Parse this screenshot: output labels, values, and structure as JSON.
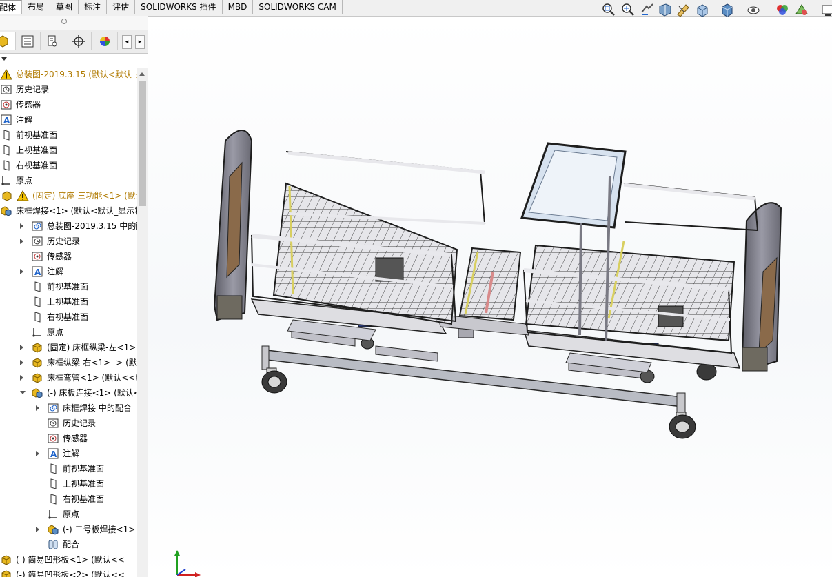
{
  "tabs": [
    {
      "label": "配体",
      "active": true
    },
    {
      "label": "布局",
      "active": false
    },
    {
      "label": "草图",
      "active": false
    },
    {
      "label": "标注",
      "active": false
    },
    {
      "label": "评估",
      "active": false
    },
    {
      "label": "SOLIDWORKS 插件",
      "active": false
    },
    {
      "label": "MBD",
      "active": false
    },
    {
      "label": "SOLIDWORKS CAM",
      "active": false
    }
  ],
  "heads_up_toolbar": [
    "zoom-to-fit-icon",
    "zoom-to-area-icon",
    "previous-view-icon",
    "section-view-icon",
    "dynamic-annotation-icon",
    "view-orientation-icon",
    "display-style-icon",
    "hide-show-items-icon",
    "edit-appearance-icon",
    "apply-scene-icon",
    "view-settings-icon"
  ],
  "pane_tabs": [
    "feature-manager-icon",
    "property-manager-icon",
    "configuration-manager-icon",
    "dimxpert-manager-icon",
    "display-manager-icon"
  ],
  "tree": [
    {
      "label": "总装图-2019.3.15  (默认<默认_显",
      "icon": "warning-icon",
      "warn": true
    },
    {
      "label": "历史记录",
      "icon": "history-icon"
    },
    {
      "label": "传感器",
      "icon": "sensor-icon"
    },
    {
      "label": "注解",
      "icon": "annotation-icon"
    },
    {
      "label": "前视基准面",
      "icon": "plane-icon"
    },
    {
      "label": "上视基准面",
      "icon": "plane-icon"
    },
    {
      "label": "右视基准面",
      "icon": "plane-icon"
    },
    {
      "label": "原点",
      "icon": "origin-icon"
    },
    {
      "label": "(固定) 底座-三功能<1> (默认",
      "icon": "part-warning-icon",
      "warn": true
    },
    {
      "label": "床框焊接<1> (默认<默认_显示状",
      "icon": "subassembly-icon"
    },
    {
      "label": "总装图-2019.3.15 中的配合",
      "icon": "mates-folder-icon"
    },
    {
      "label": "历史记录",
      "icon": "history-icon"
    },
    {
      "label": "传感器",
      "icon": "sensor-icon"
    },
    {
      "label": "注解",
      "icon": "annotation-icon"
    },
    {
      "label": "前视基准面",
      "icon": "plane-icon"
    },
    {
      "label": "上视基准面",
      "icon": "plane-icon"
    },
    {
      "label": "右视基准面",
      "icon": "plane-icon"
    },
    {
      "label": "原点",
      "icon": "origin-icon"
    },
    {
      "label": "(固定) 床框纵梁-左<1> (默认",
      "icon": "part-icon"
    },
    {
      "label": "床框纵梁-右<1> -> (默认<",
      "icon": "part-icon"
    },
    {
      "label": "床框弯管<1> (默认<<默认>",
      "icon": "part-icon"
    },
    {
      "label": "(-) 床板连接<1> (默认<默认",
      "icon": "subassembly-icon"
    },
    {
      "label": "床框焊接 中的配合",
      "icon": "mates-folder-icon"
    },
    {
      "label": "历史记录",
      "icon": "history-icon"
    },
    {
      "label": "传感器",
      "icon": "sensor-icon"
    },
    {
      "label": "注解",
      "icon": "annotation-icon"
    },
    {
      "label": "前视基准面",
      "icon": "plane-icon"
    },
    {
      "label": "上视基准面",
      "icon": "plane-icon"
    },
    {
      "label": "右视基准面",
      "icon": "plane-icon"
    },
    {
      "label": "原点",
      "icon": "origin-icon"
    },
    {
      "label": "(-) 二号板焊接<1> (默认",
      "icon": "subassembly-icon"
    },
    {
      "label": "配合",
      "icon": "mates-icon"
    },
    {
      "label": "(-) 简易凹形板<1> (默认<<",
      "icon": "part-icon"
    },
    {
      "label": "(-) 简易凹形板<2> (默认<<",
      "icon": "part-icon"
    }
  ],
  "model": {
    "name": "hospital-bed-assembly",
    "colors": {
      "frame": "#d8d8dc",
      "outline": "#2a2a2a",
      "headboard": "#8a6a4a",
      "motor": "#2b3f8a",
      "panel": "#d7e2ef"
    }
  },
  "triad": {
    "x_color": "#d02020",
    "y_color": "#20a020",
    "z_color": "#2040d0"
  }
}
